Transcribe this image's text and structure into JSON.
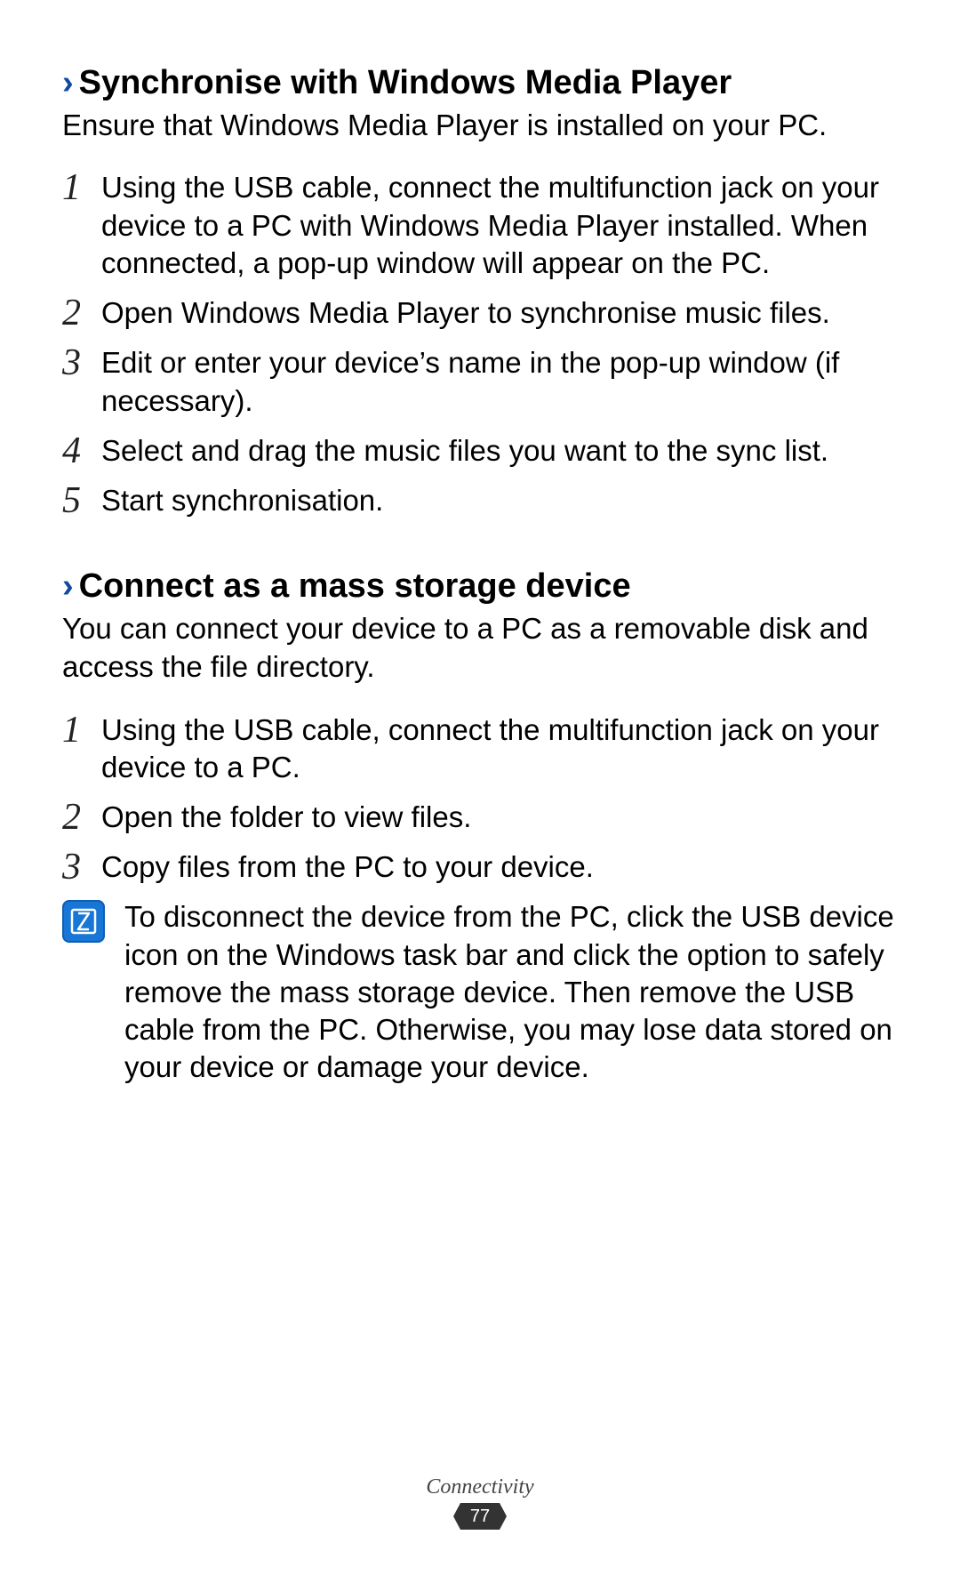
{
  "sections": [
    {
      "marker": "›",
      "title": "Synchronise with Windows Media Player",
      "intro": "Ensure that Windows Media Player is installed on your PC.",
      "steps": [
        {
          "num": "1",
          "text": "Using the USB cable, connect the multifunction jack on your device to a PC with Windows Media Player installed. When connected, a pop-up window will appear on the PC."
        },
        {
          "num": "2",
          "text": "Open Windows Media Player to synchronise music files."
        },
        {
          "num": "3",
          "text": "Edit or enter your device’s name in the pop-up window (if necessary)."
        },
        {
          "num": "4",
          "text": "Select and drag the music files you want to the sync list."
        },
        {
          "num": "5",
          "text": "Start synchronisation."
        }
      ]
    },
    {
      "marker": "›",
      "title": "Connect as a mass storage device",
      "intro": "You can connect your device to a PC as a removable disk and access the file directory.",
      "steps": [
        {
          "num": "1",
          "text": "Using the USB cable, connect the multifunction jack on your device to a PC."
        },
        {
          "num": "2",
          "text": "Open the folder to view files."
        },
        {
          "num": "3",
          "text": "Copy files from the PC to your device."
        }
      ],
      "note": "To disconnect the device from the PC, click the USB device icon on the Windows task bar and click the option to safely remove the mass storage device. Then remove the USB cable from the PC. Otherwise, you may lose data stored on your device or damage your device."
    }
  ],
  "footer": {
    "chapter": "Connectivity",
    "page": "77"
  }
}
